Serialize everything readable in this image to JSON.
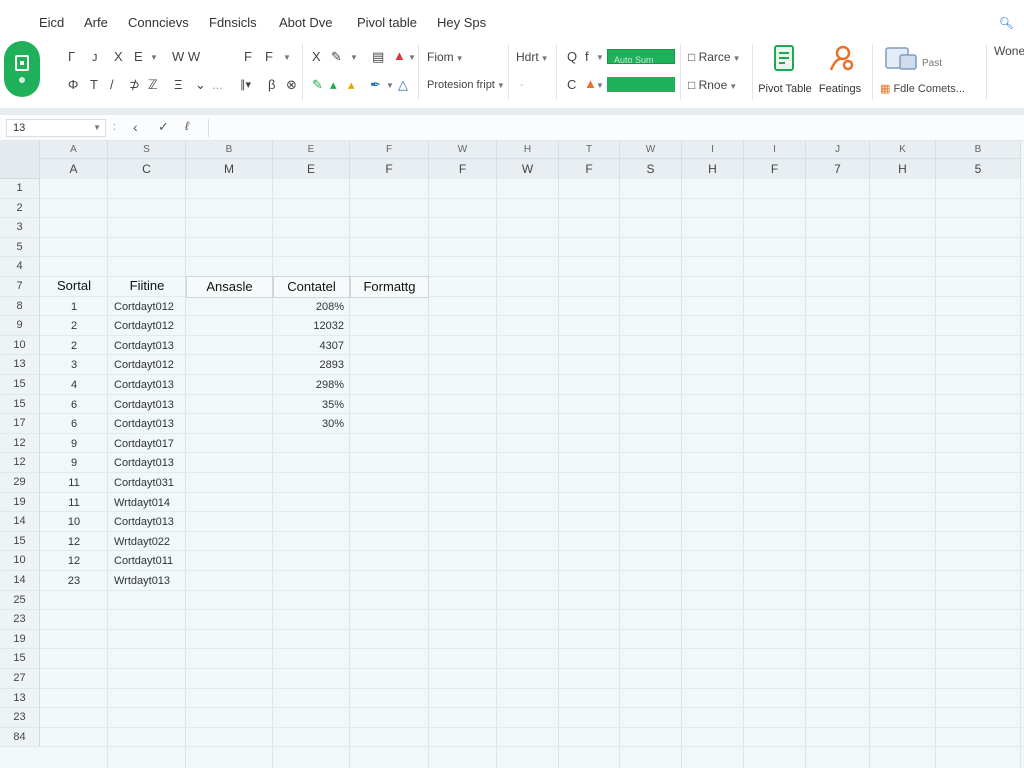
{
  "menu": {
    "items": [
      "Eicd",
      "Arfe",
      "Conncievs",
      "Fdnsicls",
      "Abot Dve",
      "Pivol table",
      "Hey Sps"
    ],
    "search_icon": "search-icon"
  },
  "ribbon": {
    "font_row1": [
      "Γ",
      "ᴊ",
      "X",
      "E",
      "W W",
      "F",
      "F"
    ],
    "font_row2": [
      "Φ",
      "T",
      "/",
      "⊅",
      "ℤ",
      "Ξ",
      "⌄",
      "..."
    ],
    "group_labels": {
      "form": "Fiom",
      "protection": "Protesion fript",
      "hdr": "Hdrt",
      "fill_text": "Auto Sum",
      "rance": "Rarce",
      "rnoe": "Rnoe",
      "pivot": "Pivot Table",
      "features": "Featings",
      "past": "Past",
      "fdle": "Fdle Comets...",
      "wone": "Wone"
    }
  },
  "formula_bar": {
    "name_box": "13",
    "separator": ":"
  },
  "columns": [
    {
      "top": "A",
      "bottom": "A"
    },
    {
      "top": "S",
      "bottom": "C"
    },
    {
      "top": "B",
      "bottom": "M"
    },
    {
      "top": "E",
      "bottom": "E"
    },
    {
      "top": "F",
      "bottom": "F"
    },
    {
      "top": "W",
      "bottom": "F"
    },
    {
      "top": "H",
      "bottom": "W"
    },
    {
      "top": "T",
      "bottom": "F"
    },
    {
      "top": "W",
      "bottom": "S"
    },
    {
      "top": "I",
      "bottom": "H"
    },
    {
      "top": "I",
      "bottom": "F"
    },
    {
      "top": "J",
      "bottom": "7"
    },
    {
      "top": "K",
      "bottom": "H"
    },
    {
      "top": "B",
      "bottom": "5"
    }
  ],
  "rows": [
    "1",
    "2",
    "3",
    "5",
    "4",
    "7",
    "8",
    "9",
    "10",
    "13",
    "15",
    "15",
    "17",
    "12",
    "12",
    "29",
    "19",
    "14",
    "15",
    "10",
    "14",
    "25",
    "23",
    "19",
    "15",
    "27",
    "13",
    "23",
    "84"
  ],
  "table": {
    "headers": [
      "Sortal",
      "Fiitine",
      "Ansasle",
      "Contatel",
      "Formattg"
    ],
    "rows": [
      {
        "a": "1",
        "b": "Cortdayt012",
        "e": "208%"
      },
      {
        "a": "2",
        "b": "Cortdayt012",
        "e": "12032"
      },
      {
        "a": "2",
        "b": "Cortdayt013",
        "e": "4307"
      },
      {
        "a": "3",
        "b": "Cortdayt012",
        "e": "2893"
      },
      {
        "a": "4",
        "b": "Cortdayt013",
        "e": "298%"
      },
      {
        "a": "6",
        "b": "Cortdayt013",
        "e": "35%"
      },
      {
        "a": "6",
        "b": "Cortdayt013",
        "e": "30%"
      },
      {
        "a": "9",
        "b": "Cortdayt017",
        "e": ""
      },
      {
        "a": "9",
        "b": "Cortdayt013",
        "e": ""
      },
      {
        "a": "11",
        "b": "Cortdayt031",
        "e": ""
      },
      {
        "a": "11",
        "b": "Wrtdayt014",
        "e": ""
      },
      {
        "a": "10",
        "b": "Cortdayt013",
        "e": ""
      },
      {
        "a": "12",
        "b": "Wrtdayt022",
        "e": ""
      },
      {
        "a": "12",
        "b": "Cortdayt011",
        "e": ""
      },
      {
        "a": "23",
        "b": "Wrtdayt013",
        "e": ""
      }
    ]
  }
}
